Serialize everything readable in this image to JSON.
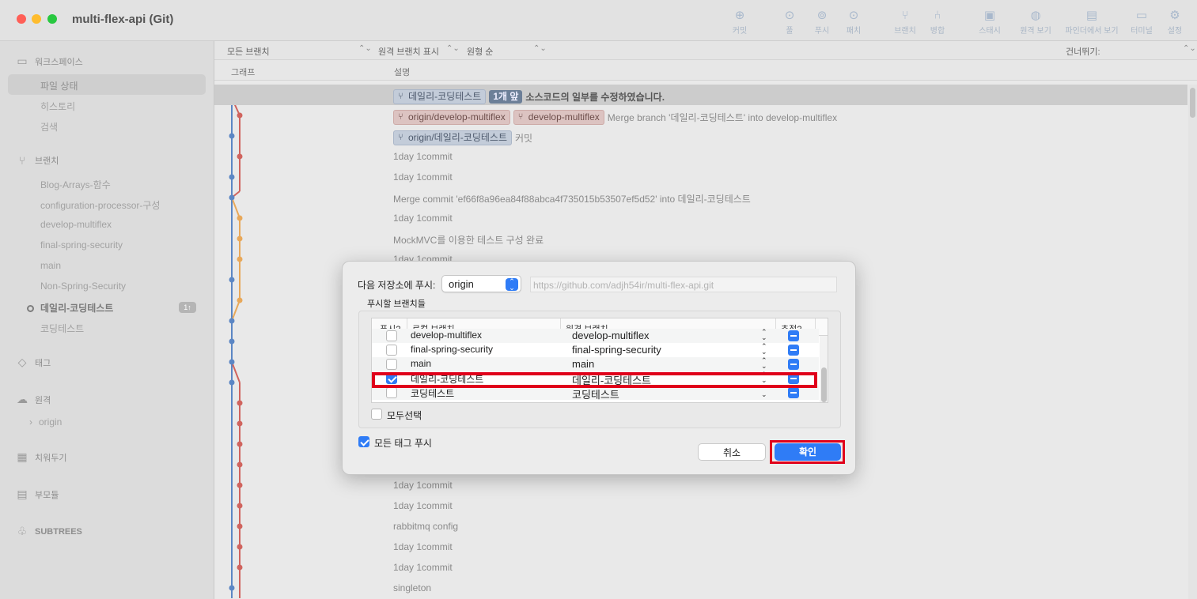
{
  "window": {
    "title": "multi-flex-api (Git)"
  },
  "toolbar": [
    {
      "label": "커밋",
      "icon": "plus-circle-icon",
      "glyph": "⊕"
    },
    {
      "label": "풀",
      "icon": "arrow-down-circle-icon",
      "glyph": "⊙"
    },
    {
      "label": "푸시",
      "icon": "arrow-up-circle-icon",
      "glyph": "⊚"
    },
    {
      "label": "패치",
      "icon": "fetch-icon",
      "glyph": "⊙"
    },
    {
      "label": "브랜치",
      "icon": "branch-icon",
      "glyph": "⑂"
    },
    {
      "label": "병합",
      "icon": "merge-icon",
      "glyph": "⑃"
    },
    {
      "label": "스태시",
      "icon": "stash-icon",
      "glyph": "▣"
    },
    {
      "label": "원격 보기",
      "icon": "globe-icon",
      "glyph": "◍"
    },
    {
      "label": "파인더에서 보기",
      "icon": "finder-icon",
      "glyph": "▤"
    },
    {
      "label": "터미널",
      "icon": "terminal-icon",
      "glyph": "▭"
    },
    {
      "label": "설정",
      "icon": "gear-icon",
      "glyph": "⚙"
    }
  ],
  "sidebar": {
    "workspace": {
      "label": "워크스페이스",
      "items": [
        "파일 상태",
        "히스토리",
        "검색"
      ]
    },
    "branches": {
      "label": "브랜치",
      "items": [
        "Blog-Arrays-함수",
        "configuration-processor-구성",
        "develop-multiflex",
        "final-spring-security",
        "main",
        "Non-Spring-Security",
        "데일리-코딩테스트",
        "코딩테스트"
      ],
      "current_badge": "1↑"
    },
    "tags": {
      "label": "태그"
    },
    "remotes": {
      "label": "원격",
      "items": [
        "origin"
      ]
    },
    "stashes": {
      "label": "치워두기"
    },
    "submodules": {
      "label": "부모듈"
    },
    "subtrees": {
      "label": "SUBTREES"
    }
  },
  "filters": {
    "branches": "모든 브랜치",
    "remote_branches": "원격 브랜치 표시",
    "order": "원형 순",
    "jump": "건너뛰기:"
  },
  "columns": {
    "graph": "그래프",
    "description": "설명"
  },
  "commits": [
    {
      "tags": [
        {
          "text": "데일리-코딩테스트",
          "kind": "blue"
        },
        {
          "text": "1개 앞",
          "kind": "ahead"
        }
      ],
      "message": "소스코드의 일부를 수정하였습니다.",
      "selected": true
    },
    {
      "tags": [
        {
          "text": "origin/develop-multiflex",
          "kind": "red"
        },
        {
          "text": "develop-multiflex",
          "kind": "red"
        }
      ],
      "message": "Merge branch '데일리-코딩테스트' into develop-multiflex"
    },
    {
      "tags": [
        {
          "text": "origin/데일리-코딩테스트",
          "kind": "blue"
        }
      ],
      "message": "커밋"
    },
    {
      "tags": [],
      "message": "1day 1commit"
    },
    {
      "tags": [],
      "message": "1day 1commit"
    },
    {
      "tags": [],
      "message": "Merge commit 'ef66f8a96ea84f88abca4f735015b53507ef5d52' into 데일리-코딩테스트"
    },
    {
      "tags": [],
      "message": "1day 1commit"
    },
    {
      "tags": [],
      "message": "MockMVC를 이용한 테스트 구성 완료"
    },
    {
      "tags": [],
      "message": "1day 1commit"
    },
    {
      "tags": [],
      "message": ""
    },
    {
      "tags": [],
      "message": ""
    },
    {
      "tags": [],
      "message": ""
    },
    {
      "tags": [],
      "message": ""
    },
    {
      "tags": [],
      "message": ""
    },
    {
      "tags": [],
      "message": ""
    },
    {
      "tags": [],
      "message": ""
    },
    {
      "tags": [],
      "message": ""
    },
    {
      "tags": [],
      "message": ""
    },
    {
      "tags": [],
      "message": ""
    },
    {
      "tags": [],
      "message": "1day 1commit"
    },
    {
      "tags": [],
      "message": "1day 1commit"
    },
    {
      "tags": [],
      "message": "rabbitmq config"
    },
    {
      "tags": [],
      "message": "1day 1commit"
    },
    {
      "tags": [],
      "message": "1day 1commit"
    },
    {
      "tags": [],
      "message": "singleton"
    }
  ],
  "dialog": {
    "push_to_label": "다음 저장소에 푸시:",
    "remote": "origin",
    "remote_url": "https://github.com/adjh54ir/multi-flex-api.git",
    "branches_group": "푸시할 브랜치들",
    "table_headers": {
      "push": "푸시?",
      "local": "로컬 브랜치",
      "remote": "원격 브랜치",
      "track": "추적?"
    },
    "rows": [
      {
        "push": false,
        "local": "develop-multiflex",
        "remote": "develop-multiflex",
        "track": true
      },
      {
        "push": false,
        "local": "final-spring-security",
        "remote": "final-spring-security",
        "track": true
      },
      {
        "push": false,
        "local": "main",
        "remote": "main",
        "track": true
      },
      {
        "push": true,
        "local": "데일리-코딩테스트",
        "remote": "데일리-코딩테스트",
        "track": true
      },
      {
        "push": false,
        "local": "코딩테스트",
        "remote": "코딩테스트",
        "track": true
      }
    ],
    "select_all": "모두선택",
    "push_all_tags": "모든 태그 푸시",
    "push_all_tags_checked": true,
    "cancel": "취소",
    "ok": "확인"
  },
  "colors": {
    "accent": "#2f7cf6",
    "highlight": "#e0001b",
    "graph_blue": "#5b86c4",
    "graph_red": "#d0645e",
    "graph_orange": "#e8a85a"
  }
}
